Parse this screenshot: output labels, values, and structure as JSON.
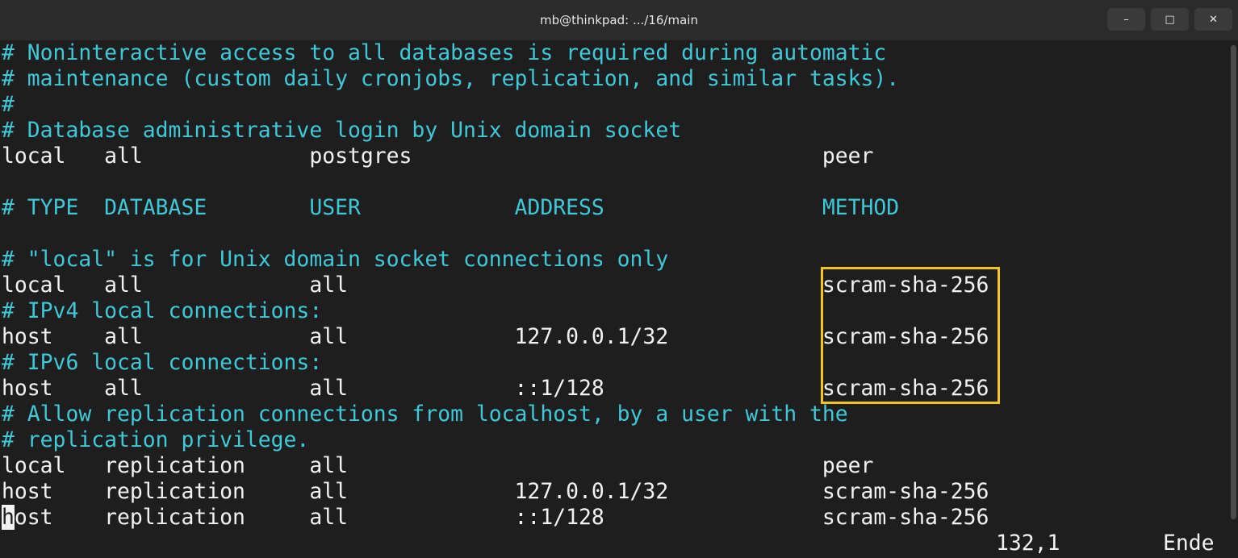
{
  "window": {
    "title": "mb@thinkpad: .../16/main",
    "minimize_label": "–",
    "maximize_label": "□",
    "close_label": "✕"
  },
  "editor": {
    "lines": [
      {
        "text": "# Noninteractive access to all databases is required during automatic",
        "comment": true
      },
      {
        "text": "# maintenance (custom daily cronjobs, replication, and similar tasks).",
        "comment": true
      },
      {
        "text": "#",
        "comment": true
      },
      {
        "text": "# Database administrative login by Unix domain socket",
        "comment": true
      },
      {
        "text": "local   all             postgres                                peer",
        "comment": false
      },
      {
        "text": "",
        "comment": false
      },
      {
        "text": "# TYPE  DATABASE        USER            ADDRESS                 METHOD",
        "comment": true
      },
      {
        "text": "",
        "comment": false
      },
      {
        "text": "# \"local\" is for Unix domain socket connections only",
        "comment": true
      },
      {
        "text": "local   all             all                                     scram-sha-256",
        "comment": false
      },
      {
        "text": "# IPv4 local connections:",
        "comment": true
      },
      {
        "text": "host    all             all             127.0.0.1/32            scram-sha-256",
        "comment": false
      },
      {
        "text": "# IPv6 local connections:",
        "comment": true
      },
      {
        "text": "host    all             all             ::1/128                 scram-sha-256",
        "comment": false
      },
      {
        "text": "# Allow replication connections from localhost, by a user with the",
        "comment": true
      },
      {
        "text": "# replication privilege.",
        "comment": true
      },
      {
        "text": "local   replication     all                                     peer",
        "comment": false
      },
      {
        "text": "host    replication     all             127.0.0.1/32            scram-sha-256",
        "comment": false
      }
    ],
    "cursor_line": {
      "cursor_char": "h",
      "rest": "ost    replication     all             ::1/128                 scram-sha-256"
    },
    "status": {
      "position": "132,1",
      "scroll": "Ende"
    },
    "colors": {
      "comment": "#3ec8d8",
      "text": "#f2f2f2",
      "highlight_box": "#f5c518"
    }
  }
}
